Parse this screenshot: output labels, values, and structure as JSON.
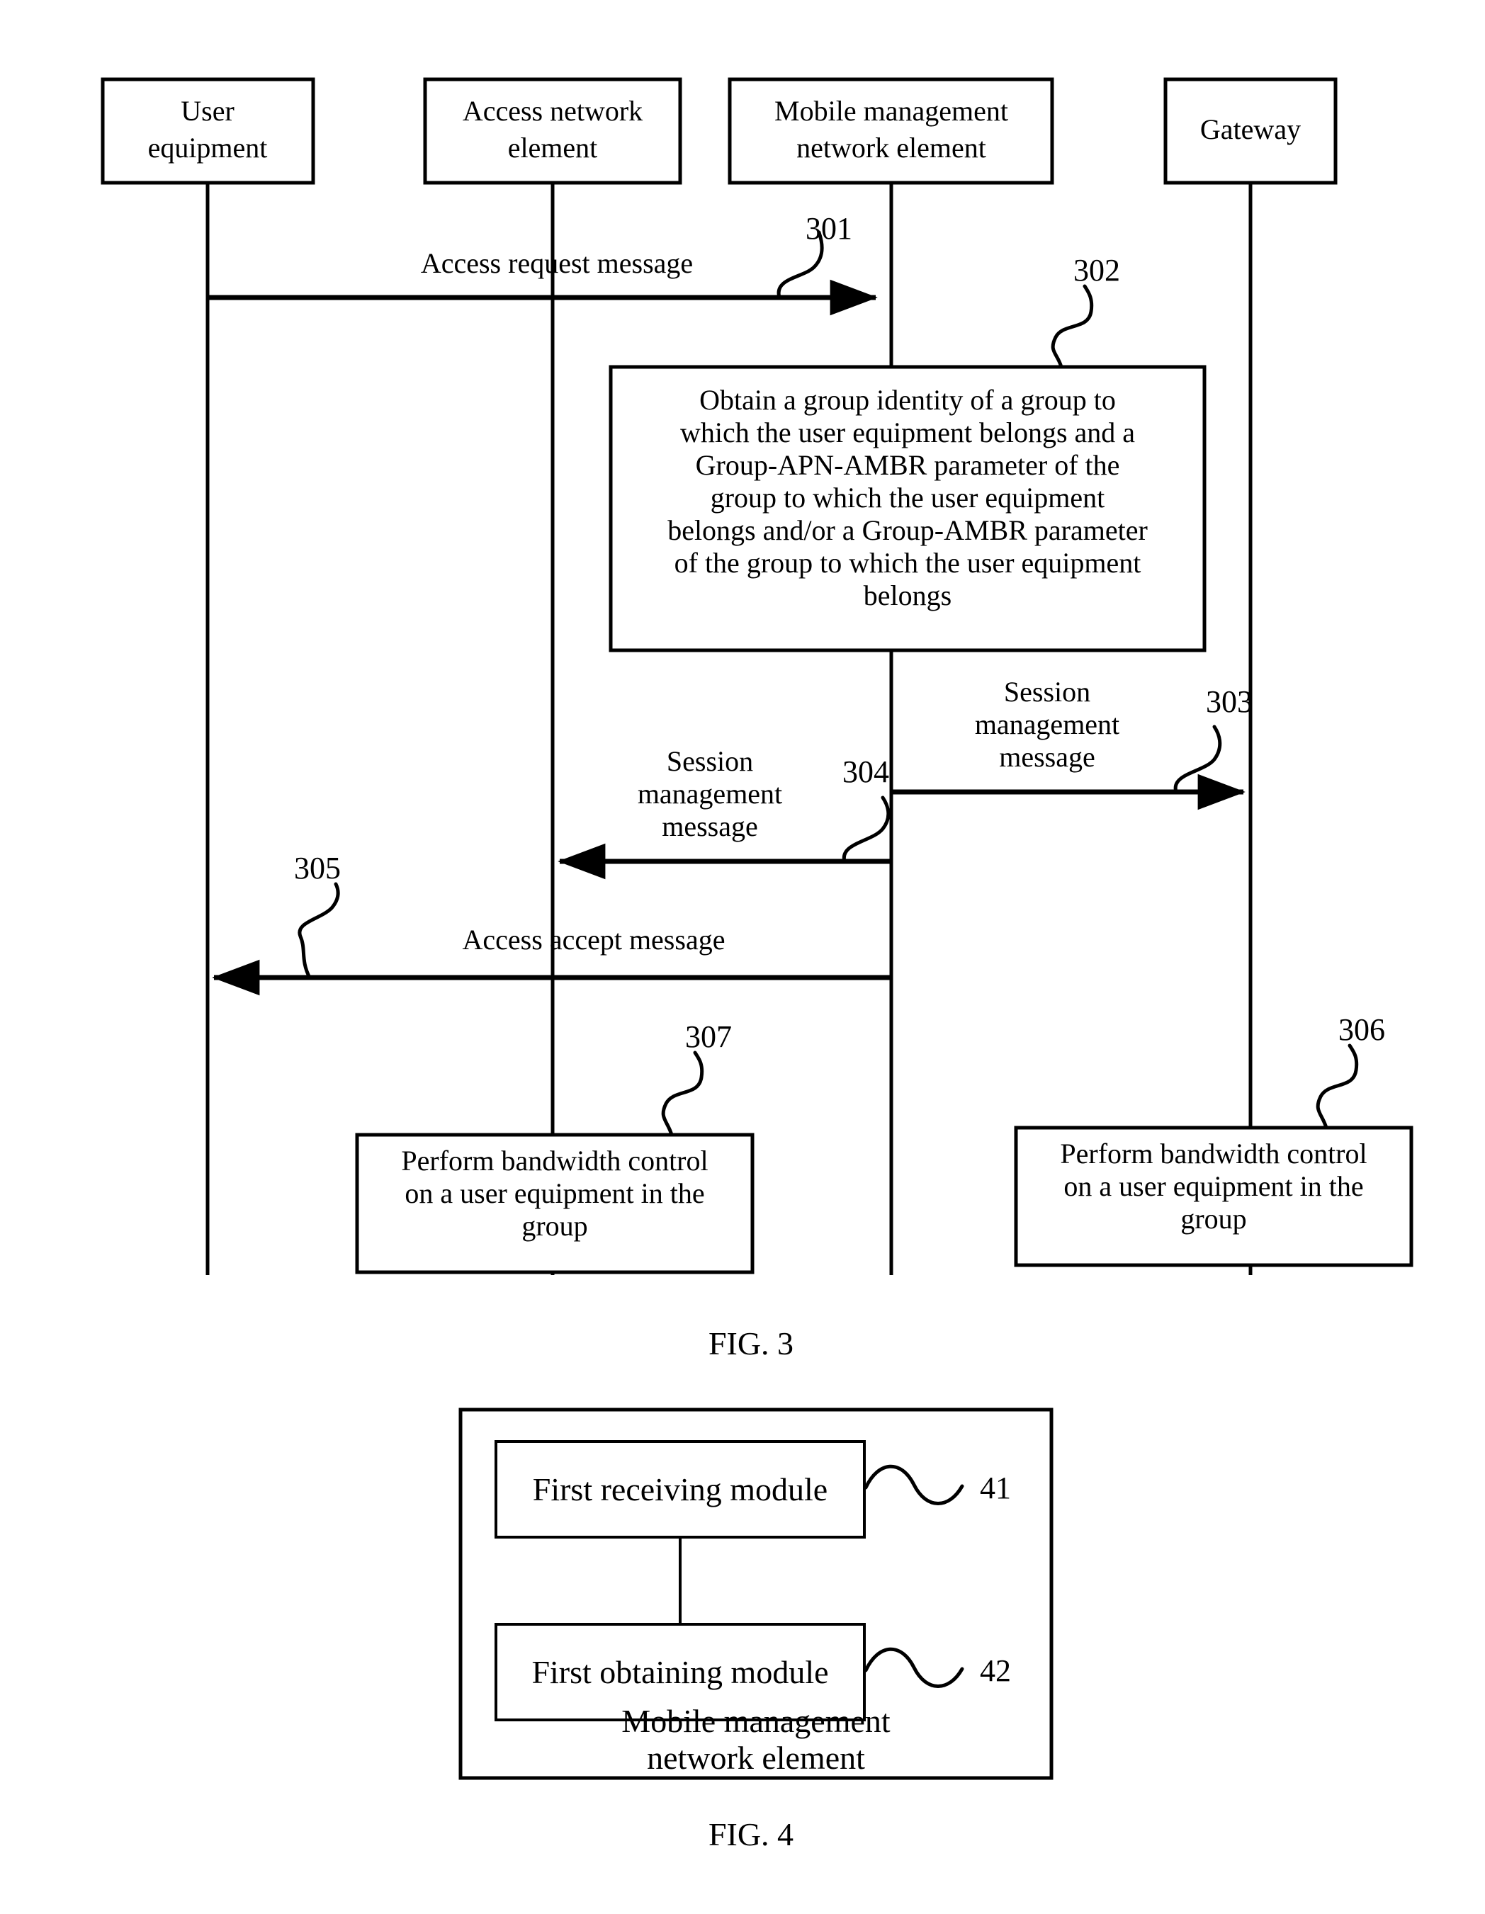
{
  "figure3": {
    "caption": "FIG. 3",
    "lifelines": [
      {
        "id": "user-equipment",
        "label_line1": "User",
        "label_line2": "equipment"
      },
      {
        "id": "access-network-element",
        "label_line1": "Access network",
        "label_line2": "element"
      },
      {
        "id": "mobile-management-network-element",
        "label_line1": "Mobile management",
        "label_line2": "network element"
      },
      {
        "id": "gateway",
        "label_line1": "Gateway",
        "label_line2": ""
      }
    ],
    "messages": [
      {
        "ref": "301",
        "label": "Access request message",
        "from": "user-equipment",
        "to": "mobile-management-network-element",
        "direction": "right"
      },
      {
        "ref": "303",
        "label_line1": "Session",
        "label_line2": "management",
        "label_line3": "message",
        "from": "mobile-management-network-element",
        "to": "gateway",
        "direction": "right"
      },
      {
        "ref": "304",
        "label_line1": "Session",
        "label_line2": "management",
        "label_line3": "message",
        "from": "mobile-management-network-element",
        "to": "access-network-element",
        "direction": "left"
      },
      {
        "ref": "305",
        "label": "Access accept message",
        "from": "mobile-management-network-element",
        "to": "user-equipment",
        "direction": "left"
      }
    ],
    "process_boxes": [
      {
        "ref": "302",
        "on": "mobile-management-network-element",
        "lines": [
          "Obtain a group identity of a group to",
          "which the user equipment belongs and a",
          "Group-APN-AMBR parameter of the",
          "group to which the user equipment",
          "belongs and/or a Group-AMBR parameter",
          "of the group to which the user equipment",
          "belongs"
        ]
      },
      {
        "ref": "307",
        "on": "access-network-element",
        "lines": [
          "Perform bandwidth control",
          "on a user equipment in the",
          "group"
        ]
      },
      {
        "ref": "306",
        "on": "gateway",
        "lines": [
          "Perform bandwidth control",
          "on a user equipment in the",
          "group"
        ]
      }
    ]
  },
  "figure4": {
    "caption": "FIG. 4",
    "container_label_line1": "Mobile management",
    "container_label_line2": "network element",
    "modules": [
      {
        "label": "First receiving module",
        "ref": "41"
      },
      {
        "label": "First obtaining module",
        "ref": "42"
      }
    ]
  },
  "colors": {
    "ink": "#000000",
    "paper": "#ffffff"
  }
}
